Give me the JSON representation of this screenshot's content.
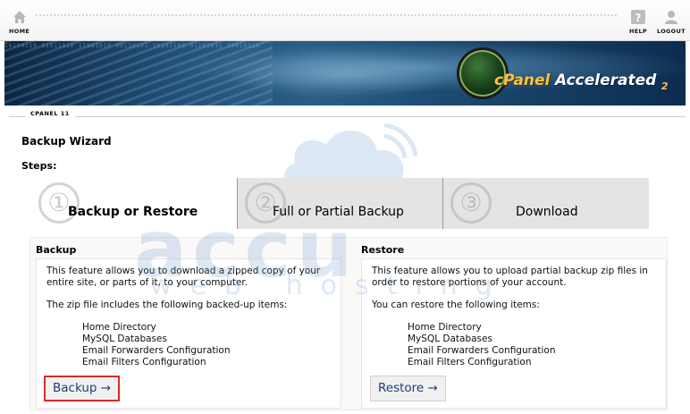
{
  "topnav": {
    "home_label": "HOME",
    "help_label": "HELP",
    "logout_label": "LOGOUT"
  },
  "banner": {
    "logo_cpanel": "cPanel",
    "logo_accelerated": "Accelerated",
    "logo_version": "2"
  },
  "breadcrumb": {
    "label": "CPANEL 11"
  },
  "page": {
    "title": "Backup Wizard",
    "steps_label": "Steps:"
  },
  "steps": [
    {
      "number": "①",
      "label": "Backup or Restore",
      "active": true
    },
    {
      "number": "②",
      "label": "Full or Partial Backup",
      "active": false
    },
    {
      "number": "③",
      "label": "Download",
      "active": false
    }
  ],
  "backup": {
    "title": "Backup",
    "description": "This feature allows you to download a zipped copy of your entire site, or parts of it, to your computer.",
    "list_intro": "The zip file includes the following backed-up items:",
    "items": [
      "Home Directory",
      "MySQL Databases",
      "Email Forwarders Configuration",
      "Email Filters Configuration"
    ],
    "button_label": "Backup →"
  },
  "restore": {
    "title": "Restore",
    "description": "This feature allows you to upload partial backup zip files in order to restore portions of your account.",
    "list_intro": "You can restore the following items:",
    "items": [
      "Home Directory",
      "MySQL Databases",
      "Email Forwarders Configuration",
      "Email Filters Configuration"
    ],
    "button_label": "Restore →"
  },
  "watermark": {
    "main": "accu",
    "sub": "web hosting"
  },
  "colors": {
    "button_text": "#1a3f78",
    "highlight_border": "#d62b2b",
    "inactive_tab_bg": "#e4e4e4",
    "banner_dark": "#0b2846",
    "logo_gold": "#f3c24a"
  }
}
